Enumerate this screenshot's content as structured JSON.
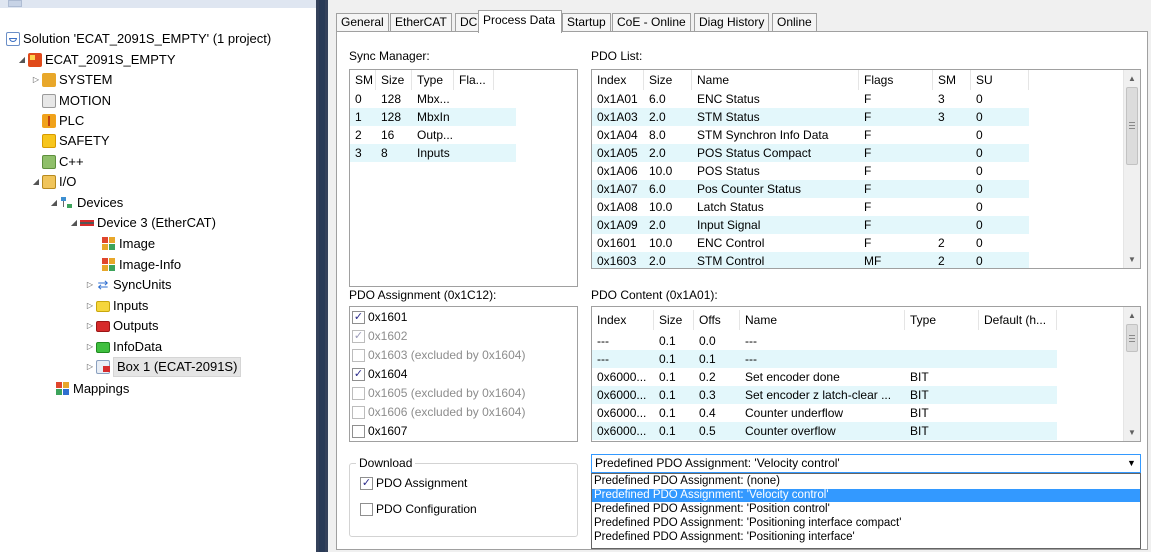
{
  "tree": {
    "items": [
      {
        "label": "Solution 'ECAT_2091S_EMPTY' (1 project)",
        "expander": ""
      },
      {
        "label": "ECAT_2091S_EMPTY",
        "expander": "◢"
      },
      {
        "label": "SYSTEM",
        "expander": "▷"
      },
      {
        "label": "MOTION",
        "expander": ""
      },
      {
        "label": "PLC",
        "expander": ""
      },
      {
        "label": "SAFETY",
        "expander": ""
      },
      {
        "label": "C++",
        "expander": ""
      },
      {
        "label": "I/O",
        "expander": "◢"
      },
      {
        "label": "Devices",
        "expander": "◢"
      },
      {
        "label": "Device 3 (EtherCAT)",
        "expander": "◢"
      },
      {
        "label": "Image",
        "expander": ""
      },
      {
        "label": "Image-Info",
        "expander": ""
      },
      {
        "label": "SyncUnits",
        "expander": "▷"
      },
      {
        "label": "Inputs",
        "expander": "▷"
      },
      {
        "label": "Outputs",
        "expander": "▷"
      },
      {
        "label": "InfoData",
        "expander": "▷"
      },
      {
        "label": "Box 1 (ECAT-2091S)",
        "expander": "▷"
      },
      {
        "label": "Mappings",
        "expander": ""
      }
    ]
  },
  "tabs": [
    "General",
    "EtherCAT",
    "DC",
    "Process Data",
    "Startup",
    "CoE - Online",
    "Diag History",
    "Online"
  ],
  "sync_manager": {
    "label": "Sync Manager:",
    "columns": [
      "SM",
      "Size",
      "Type",
      "Fla..."
    ],
    "rows": [
      [
        "0",
        "128",
        "Mbx...",
        ""
      ],
      [
        "1",
        "128",
        "MbxIn",
        ""
      ],
      [
        "2",
        "16",
        "Outp...",
        ""
      ],
      [
        "3",
        "8",
        "Inputs",
        ""
      ]
    ]
  },
  "pdo_list": {
    "label": "PDO List:",
    "columns": [
      "Index",
      "Size",
      "Name",
      "Flags",
      "SM",
      "SU"
    ],
    "rows": [
      [
        "0x1A01",
        "6.0",
        "ENC Status",
        "F",
        "3",
        "0"
      ],
      [
        "0x1A03",
        "2.0",
        "STM Status",
        "F",
        "3",
        "0"
      ],
      [
        "0x1A04",
        "8.0",
        "STM Synchron Info Data",
        "F",
        "",
        "0"
      ],
      [
        "0x1A05",
        "2.0",
        "POS Status Compact",
        "F",
        "",
        "0"
      ],
      [
        "0x1A06",
        "10.0",
        "POS Status",
        "F",
        "",
        "0"
      ],
      [
        "0x1A07",
        "6.0",
        "Pos Counter Status",
        "F",
        "",
        "0"
      ],
      [
        "0x1A08",
        "10.0",
        "Latch Status",
        "F",
        "",
        "0"
      ],
      [
        "0x1A09",
        "2.0",
        "Input Signal",
        "F",
        "",
        "0"
      ],
      [
        "0x1601",
        "10.0",
        "ENC Control",
        "F",
        "2",
        "0"
      ],
      [
        "0x1603",
        "2.0",
        "STM Control",
        "MF",
        "2",
        "0"
      ]
    ]
  },
  "pdo_assignment": {
    "label": "PDO Assignment (0x1C12):",
    "items": [
      {
        "label": "0x1601",
        "checked": "✓",
        "disabled": false
      },
      {
        "label": "0x1602",
        "checked": "✓",
        "disabled": true
      },
      {
        "label": "0x1603 (excluded by 0x1604)",
        "checked": "",
        "disabled": true
      },
      {
        "label": "0x1604",
        "checked": "✓",
        "disabled": false
      },
      {
        "label": "0x1605 (excluded by 0x1604)",
        "checked": "",
        "disabled": true
      },
      {
        "label": "0x1606 (excluded by 0x1604)",
        "checked": "",
        "disabled": true
      },
      {
        "label": "0x1607",
        "checked": "",
        "disabled": false
      }
    ]
  },
  "pdo_content": {
    "label": "PDO Content (0x1A01):",
    "columns": [
      "Index",
      "Size",
      "Offs",
      "Name",
      "Type",
      "Default (h..."
    ],
    "rows": [
      [
        "---",
        "0.1",
        "0.0",
        "---",
        "",
        ""
      ],
      [
        "---",
        "0.1",
        "0.1",
        "---",
        "",
        ""
      ],
      [
        "0x6000...",
        "0.1",
        "0.2",
        "Set encoder done",
        "BIT",
        ""
      ],
      [
        "0x6000...",
        "0.1",
        "0.3",
        "Set encoder z latch-clear ...",
        "BIT",
        ""
      ],
      [
        "0x6000...",
        "0.1",
        "0.4",
        "Counter underflow",
        "BIT",
        ""
      ],
      [
        "0x6000...",
        "0.1",
        "0.5",
        "Counter overflow",
        "BIT",
        ""
      ]
    ]
  },
  "download": {
    "title": "Download",
    "pdo_assignment": {
      "label": "PDO Assignment",
      "checked": "✓"
    },
    "pdo_configuration": {
      "label": "PDO Configuration",
      "checked": ""
    }
  },
  "predefined": {
    "selected": "Predefined PDO Assignment: 'Velocity control'",
    "options": [
      "Predefined PDO Assignment: (none)",
      "Predefined PDO Assignment: 'Velocity control'",
      "Predefined PDO Assignment: 'Position control'",
      "Predefined PDO Assignment: 'Positioning interface compact'",
      "Predefined PDO Assignment: 'Positioning interface'"
    ],
    "selected_index": 1
  },
  "colors": {
    "selection": "#3399ff",
    "row_shade": "#e3f7fb",
    "divider": "#34415a"
  }
}
